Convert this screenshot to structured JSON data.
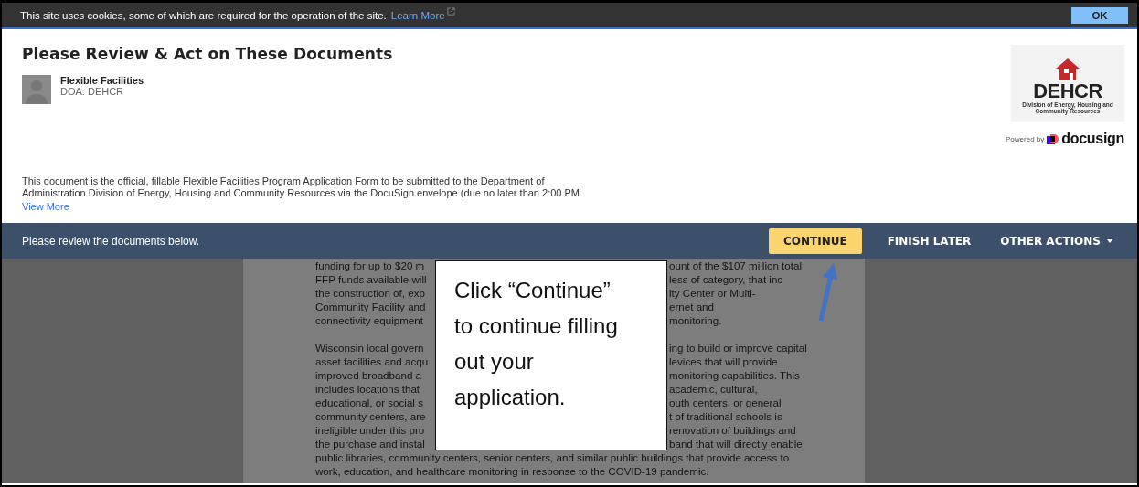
{
  "cookie_bar": {
    "message": "This site uses cookies, some of which are required for the operation of the site.",
    "link": "Learn More",
    "button": "OK"
  },
  "header": {
    "title": "Please Review & Act on These Documents",
    "sender": {
      "name": "Flexible Facilities",
      "org": "DOA: DEHCR"
    },
    "description": "This document is the official, fillable Flexible Facilities Program Application Form to be submitted to the Department of Administration Division of Energy, Housing and Community Resources via the DocuSign envelope (due no later than 2:00 PM",
    "view_more": "View More",
    "logo": {
      "name": "DEHCR",
      "subtitle": "Division of Energy, Housing and Community Resources"
    },
    "powered_by": {
      "prefix": "Powered by",
      "brand": "docusign"
    }
  },
  "action_bar": {
    "message": "Please review the documents below.",
    "buttons": [
      {
        "label": "CONTINUE",
        "kind": "primary"
      },
      {
        "label": "FINISH LATER",
        "kind": "plain"
      },
      {
        "label": "OTHER ACTIONS",
        "kind": "menu"
      }
    ]
  },
  "document": {
    "paragraphs": [
      {
        "lines": [
          {
            "left": "funding for up to $20 m",
            "right": "ount of the $107 million total"
          },
          {
            "left": "FFP funds available will",
            "right": "less of category, that inc"
          },
          {
            "left": "the construction of, exp",
            "right": "ity Center or Multi-"
          },
          {
            "left": "Community Facility and",
            "right": "ernet and"
          },
          {
            "left": "connectivity equipment",
            "right": "monitoring."
          }
        ]
      },
      {
        "lines": [
          {
            "left": "Wisconsin local govern",
            "right": "ing to build or improve capital"
          },
          {
            "left": "asset facilities and acqu",
            "right": "levices that will provide"
          },
          {
            "left": "improved broadband a",
            "right": "monitoring capabilities. This"
          },
          {
            "left": "includes locations that",
            "right": "academic, cultural,"
          },
          {
            "left": "educational, or social s",
            "right": "outh centers, or general"
          },
          {
            "left": "community centers, are",
            "right": "t of traditional schools is"
          },
          {
            "left": "ineligible under this pro",
            "right": "renovation of buildings and"
          },
          {
            "left": "the purchase and instal",
            "right": "band that will directly enable"
          },
          {
            "full": "public libraries, community centers, senior centers, and similar public buildings that provide access to"
          },
          {
            "full": "work, education, and healthcare monitoring in response to the COVID-19 pandemic."
          }
        ]
      }
    ]
  },
  "callout": {
    "lines": [
      "Click “Continue”",
      "to continue filling",
      "out your",
      "application."
    ]
  }
}
